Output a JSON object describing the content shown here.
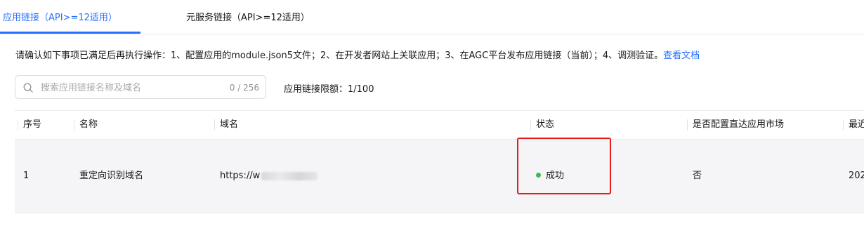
{
  "tabs": {
    "active_label": "应用链接（API>=12适用）",
    "inactive_label": "元服务链接（API>=12适用）"
  },
  "notice": {
    "text": "请确认如下事项已满足后再执行操作：1、配置应用的module.json5文件；2、在开发者网站上关联应用；3、在AGC平台发布应用链接（当前）；4、调测验证。",
    "link": "查看文档"
  },
  "search": {
    "placeholder": "搜索应用链接名称及域名",
    "value": "",
    "counter": "0 / 256"
  },
  "quota": "应用链接限额：1/100",
  "table": {
    "headers": [
      "序号",
      "名称",
      "域名",
      "状态",
      "是否配置直达应用市场",
      "最近"
    ],
    "rows": [
      {
        "index": "1",
        "name": "重定向识别域名",
        "domain": "https://w",
        "status": "成功",
        "appmarket": "否",
        "recent": "202"
      }
    ]
  },
  "colors": {
    "accent": "#256fff",
    "success": "#3fb950",
    "highlight": "#e31b1b"
  },
  "icons": [
    "search-icon",
    "status-dot-icon"
  ]
}
